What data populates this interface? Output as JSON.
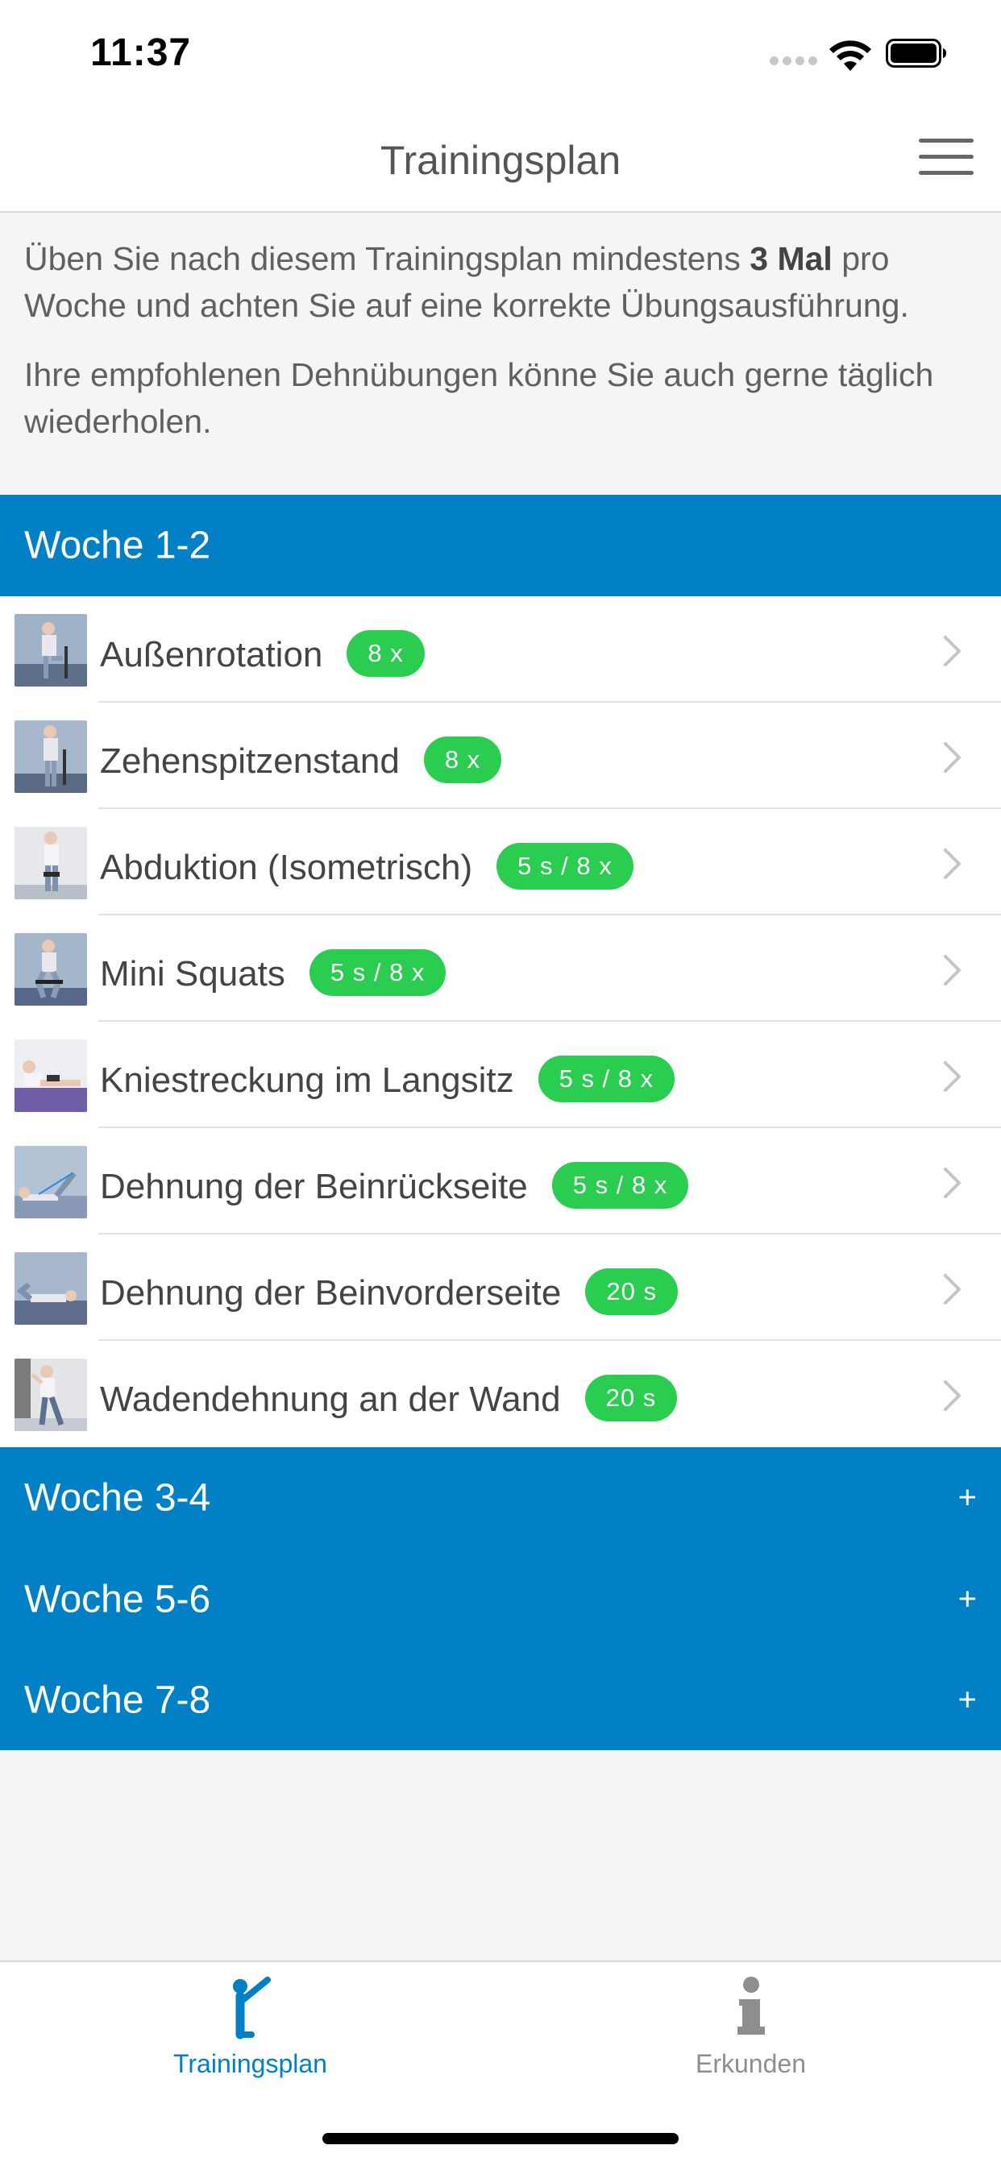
{
  "status_bar": {
    "time": "11:37"
  },
  "nav": {
    "title": "Trainingsplan",
    "menu_icon": "hamburger-menu-icon"
  },
  "intro": {
    "line1_pre": "Üben Sie nach diesem Trainingsplan mindestens ",
    "line1_bold": "3 Mal",
    "line1_post": " pro Woche und achten Sie auf eine korrekte Übungsausführung.",
    "paragraph2": "Ihre empfohlenen Dehnübungen könne Sie auch gerne täglich wiederholen."
  },
  "weeks": [
    {
      "title": "Woche 1-2",
      "expanded": true,
      "exercises": [
        {
          "name": "Außenrotation",
          "badge": "8 x"
        },
        {
          "name": "Zehenspitzenstand",
          "badge": "8 x"
        },
        {
          "name": "Abduktion (Isometrisch)",
          "badge": "5 s / 8 x"
        },
        {
          "name": "Mini Squats",
          "badge": "5 s / 8 x"
        },
        {
          "name": "Kniestreckung im Langsitz",
          "badge": "5 s / 8 x"
        },
        {
          "name": "Dehnung der Beinrückseite",
          "badge": "5 s / 8 x"
        },
        {
          "name": "Dehnung der Beinvorderseite",
          "badge": "20 s"
        },
        {
          "name": "Wadendehnung an der Wand",
          "badge": "20 s"
        }
      ]
    },
    {
      "title": "Woche 3-4",
      "expanded": false,
      "toggle": "+"
    },
    {
      "title": "Woche 5-6",
      "expanded": false,
      "toggle": "+"
    },
    {
      "title": "Woche 7-8",
      "expanded": false,
      "toggle": "+"
    }
  ],
  "tabbar": {
    "tabs": [
      {
        "label": "Trainingsplan",
        "icon": "stretching-person-icon",
        "active": true
      },
      {
        "label": "Erkunden",
        "icon": "info-icon",
        "active": false
      }
    ]
  },
  "colors": {
    "accent_blue": "#0280c6",
    "badge_green": "#2bcd51",
    "inactive_gray": "#8e8e8e"
  }
}
